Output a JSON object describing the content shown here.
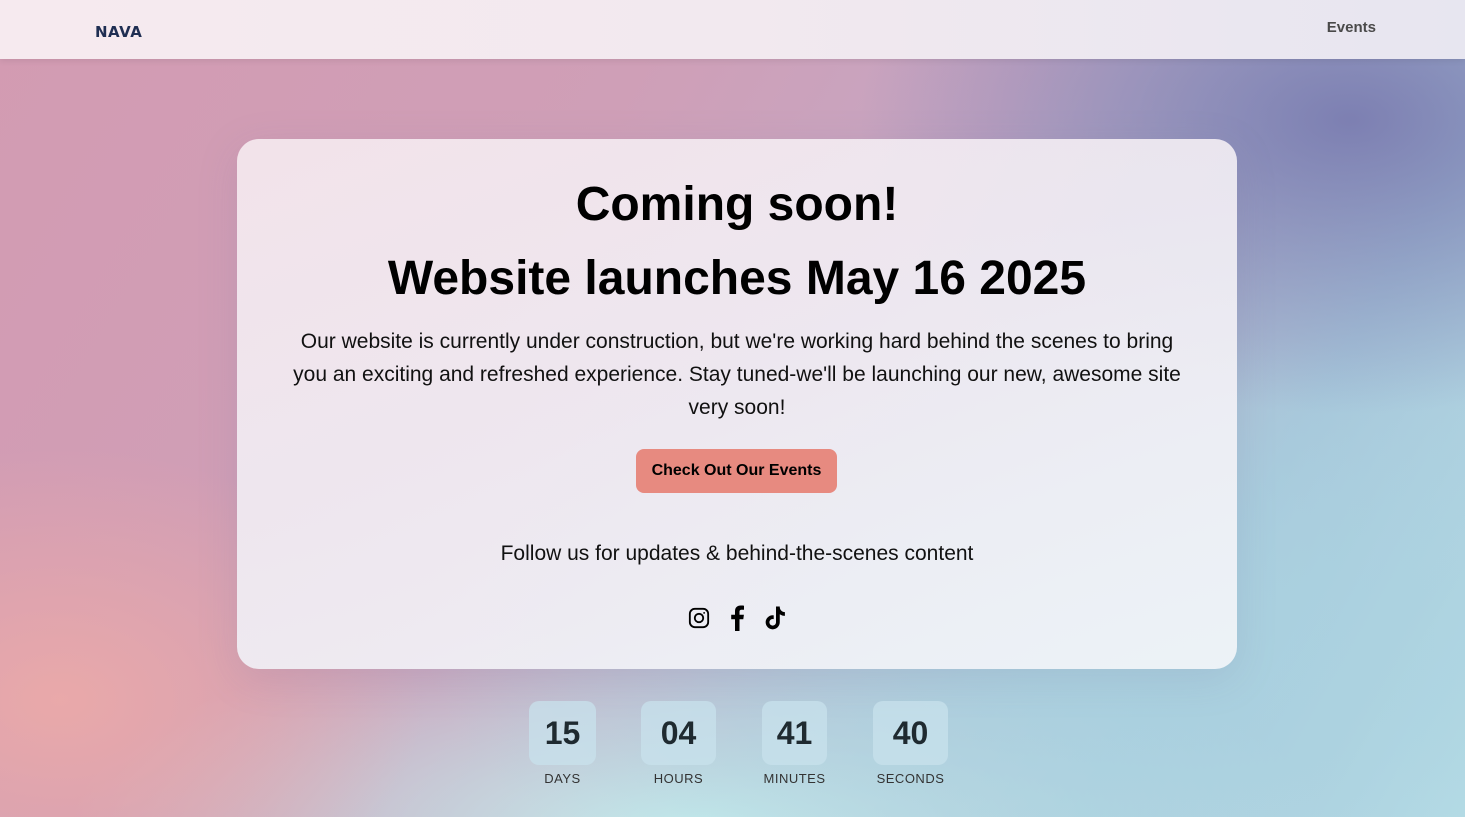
{
  "nav": {
    "logo": "NAVA",
    "links": [
      "Events"
    ]
  },
  "hero": {
    "title": "Coming soon!",
    "subtitle": "Website launches May 16 2025",
    "description": "Our website is currently under construction, but we're working hard behind the scenes to bring you an exciting and refreshed experience. Stay tuned-we'll be launching our new, awesome site very soon!",
    "cta_label": "Check Out Our Events",
    "follow_text": "Follow us for updates & behind-the-scenes content",
    "socials": [
      "instagram-icon",
      "facebook-icon",
      "tiktok-icon"
    ]
  },
  "countdown": [
    {
      "value": "15",
      "label": "DAYS"
    },
    {
      "value": "04",
      "label": "HOURS"
    },
    {
      "value": "41",
      "label": "MINUTES"
    },
    {
      "value": "40",
      "label": "SECONDS"
    }
  ],
  "colors": {
    "cta": "#e78a80",
    "logo": "#1f2e52"
  }
}
